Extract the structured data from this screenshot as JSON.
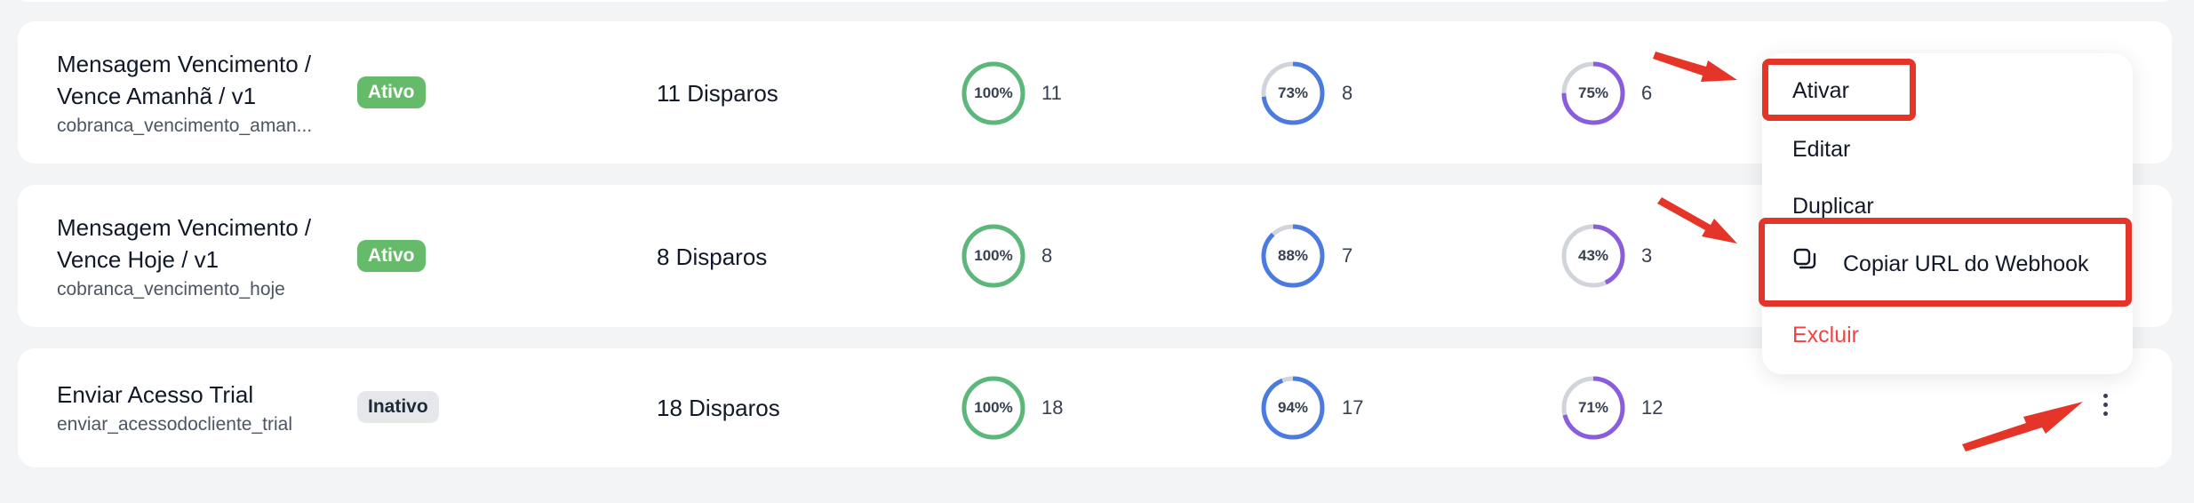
{
  "rows": [
    {
      "name": "Mensagem Vencimento /\nVence Amanhã / v1",
      "slug": "cobranca_vencimento_aman...",
      "status": "Ativo",
      "disparos": "11 Disparos",
      "metric1": {
        "pct": "100%",
        "value": 1.0,
        "count": "11",
        "color": "#5cb87a"
      },
      "metric2": {
        "pct": "73%",
        "value": 0.73,
        "count": "8",
        "color": "#4a7be0"
      },
      "metric3": {
        "pct": "75%",
        "value": 0.75,
        "count": "6",
        "color": "#8a5ce0"
      }
    },
    {
      "name": "Mensagem Vencimento /\nVence Hoje / v1",
      "slug": "cobranca_vencimento_hoje",
      "status": "Ativo",
      "disparos": "8 Disparos",
      "metric1": {
        "pct": "100%",
        "value": 1.0,
        "count": "8",
        "color": "#5cb87a"
      },
      "metric2": {
        "pct": "88%",
        "value": 0.88,
        "count": "7",
        "color": "#4a7be0"
      },
      "metric3": {
        "pct": "43%",
        "value": 0.43,
        "count": "3",
        "color": "#8a5ce0"
      }
    },
    {
      "name": "Enviar Acesso Trial",
      "slug": "enviar_acessodocliente_trial",
      "status": "Inativo",
      "disparos": "18 Disparos",
      "metric1": {
        "pct": "100%",
        "value": 1.0,
        "count": "18",
        "color": "#5cb87a"
      },
      "metric2": {
        "pct": "94%",
        "value": 0.94,
        "count": "17",
        "color": "#4a7be0"
      },
      "metric3": {
        "pct": "71%",
        "value": 0.71,
        "count": "12",
        "color": "#8a5ce0"
      }
    }
  ],
  "menu": {
    "activate": "Ativar",
    "edit": "Editar",
    "duplicate": "Duplicar",
    "copy_webhook": "Copiar URL do Webhook",
    "delete": "Excluir"
  },
  "icons": {
    "row_actions": "kebab-menu-icon",
    "copy": "copy-icon"
  },
  "colors": {
    "active_badge": "#66bb6a",
    "highlight": "#e53528",
    "danger": "#ef4444"
  }
}
